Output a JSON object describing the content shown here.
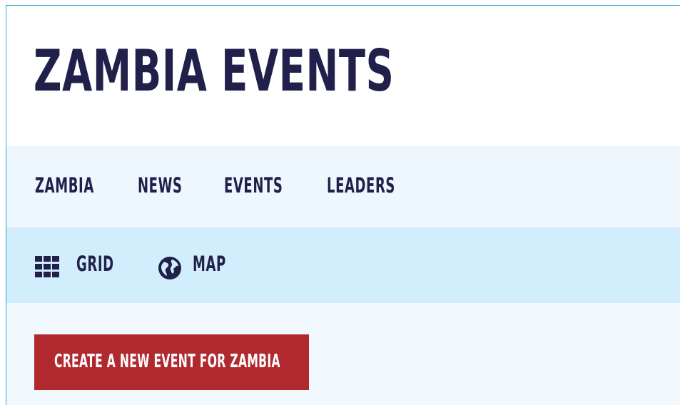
{
  "site": {
    "title": "ZAMBIA EVENTS"
  },
  "main_nav": {
    "items": [
      {
        "label": "ZAMBIA"
      },
      {
        "label": "NEWS"
      },
      {
        "label": "EVENTS"
      },
      {
        "label": "LEADERS"
      }
    ]
  },
  "view_bar": {
    "grid": {
      "label": "GRID",
      "icon": "grid-icon"
    },
    "map": {
      "label": "MAP",
      "icon": "globe-icon"
    }
  },
  "actions": {
    "create_event_label": "CREATE A NEW EVENT FOR ZAMBIA"
  },
  "colors": {
    "primary_text": "#21204a",
    "header_bg": "#ffffff",
    "nav_bg": "#eef7fe",
    "view_bar_bg": "#d2edfc",
    "content_bg": "#f1f8fe",
    "button_bg": "#b0292f",
    "frame_border": "#29a8d8"
  }
}
